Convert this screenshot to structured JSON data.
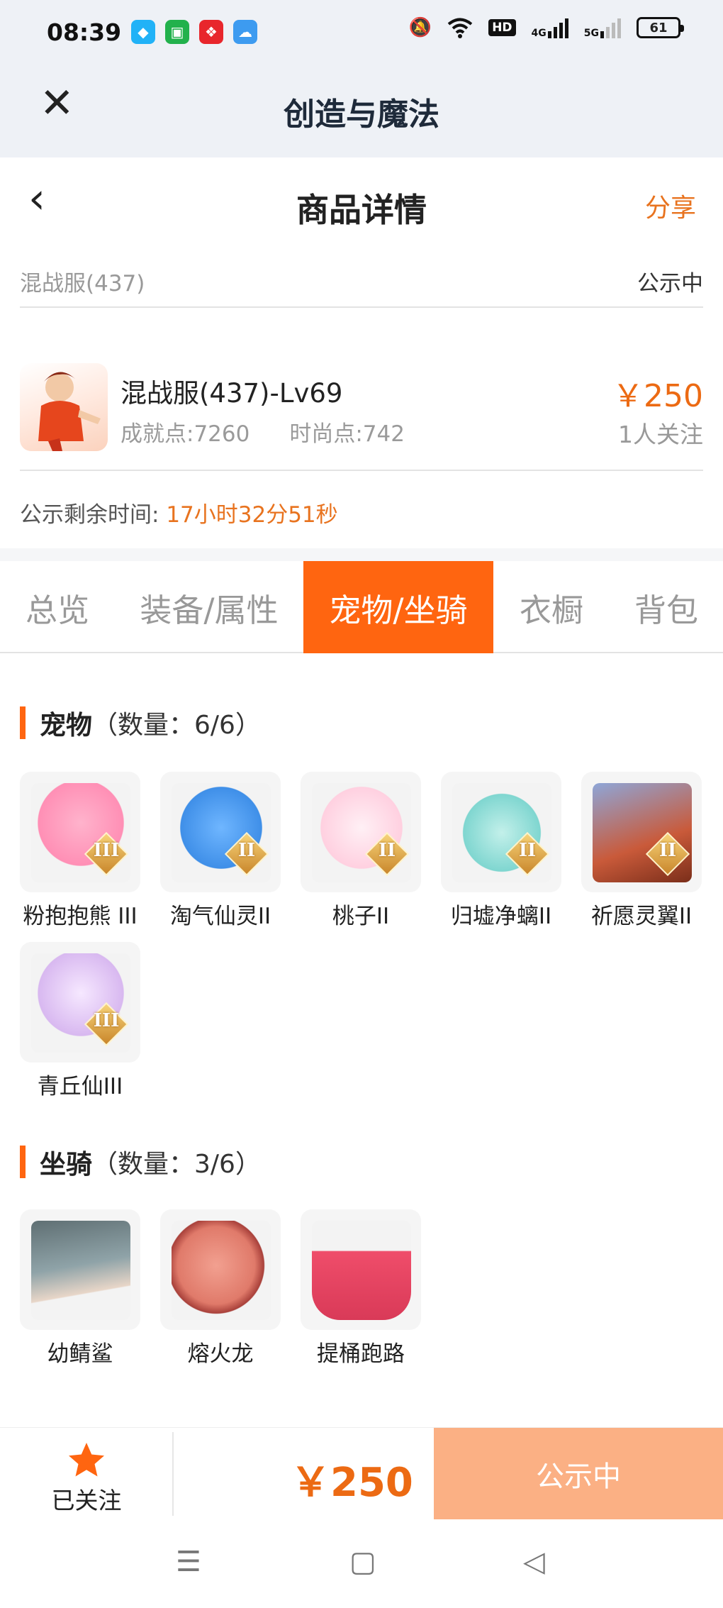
{
  "status_bar": {
    "time": "08:39",
    "hd_label": "HD",
    "net1": "4G",
    "net2": "5G",
    "battery": "61",
    "app_icons": [
      {
        "icon": "qq-icon",
        "color": "#21b2f7"
      },
      {
        "icon": "wechat-mini-icon",
        "color": "#22b14c"
      },
      {
        "icon": "lottery-icon",
        "color": "#e8262c"
      },
      {
        "icon": "weather-icon",
        "color": "#3d9bf0"
      }
    ]
  },
  "app_header": {
    "title": "创造与魔法"
  },
  "nav": {
    "title": "商品详情",
    "share_label": "分享"
  },
  "listing": {
    "server": "混战服(437)",
    "status": "公示中",
    "character_name": "混战服(437)-Lv69",
    "achievement": "成就点:7260",
    "fashion": "时尚点:742",
    "price": "￥250",
    "followers": "1人关注",
    "remaining_label": "公示剩余时间:",
    "remaining_value": "17小时32分51秒"
  },
  "tabs": [
    {
      "label": "总览",
      "active": false
    },
    {
      "label": "装备/属性",
      "active": false
    },
    {
      "label": "宠物/坐骑",
      "active": true
    },
    {
      "label": "衣橱",
      "active": false
    },
    {
      "label": "背包",
      "active": false
    }
  ],
  "pets": {
    "title": "宠物",
    "count": "（数量：6/6）",
    "items": [
      {
        "name": "粉抱抱熊 III",
        "tier": "III",
        "color": "#ff8fb5"
      },
      {
        "name": "淘气仙灵II",
        "tier": "II",
        "color": "#3f8fe8"
      },
      {
        "name": "桃子II",
        "tier": "II",
        "color": "#ffd0e0"
      },
      {
        "name": "归墟净螭II",
        "tier": "II",
        "color": "#7fd6d0"
      },
      {
        "name": "祈愿灵翼II",
        "tier": "II",
        "color": "#c95a3a"
      },
      {
        "name": "青丘仙III",
        "tier": "III",
        "color": "#d8b8f0"
      }
    ]
  },
  "mounts": {
    "title": "坐骑",
    "count": "（数量：3/6）",
    "items": [
      {
        "name": "幼鲭鲨",
        "color": "#8fa3a8"
      },
      {
        "name": "熔火龙",
        "color": "#e07a6a"
      },
      {
        "name": "提桶跑路",
        "color": "#ef4d6a"
      }
    ]
  },
  "bottom_bar": {
    "follow_label": "已关注",
    "price": "￥250",
    "status_button": "公示中"
  }
}
